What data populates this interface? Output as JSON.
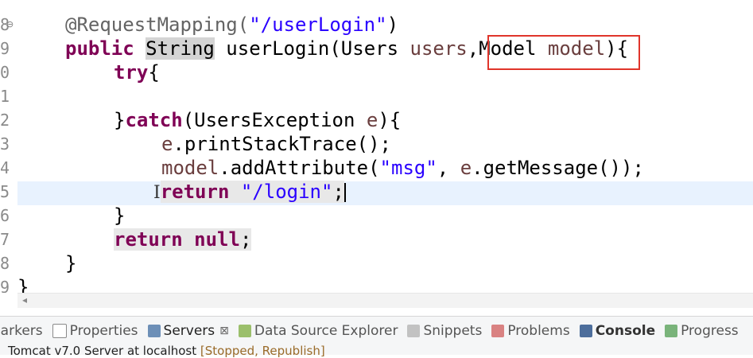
{
  "editor": {
    "line_numbers": [
      "8",
      "9",
      "0",
      "1",
      "2",
      "3",
      "4",
      "5",
      "6",
      "7",
      "8",
      "9"
    ],
    "code": {
      "l1": {
        "annotation": "@RequestMapping(",
        "path": "\"/userLogin\"",
        "close": ")"
      },
      "l2": {
        "kw_public": "public",
        "type_string": "String",
        "sig_a": " userLogin(Users ",
        "param_users": "users",
        "comma": ",",
        "type_model": "Model",
        "space": " ",
        "param_model": "model",
        "close": "){"
      },
      "l3": {
        "kw_try": "try",
        "brace": "{"
      },
      "l4": {
        "close": "}",
        "kw_catch": "catch",
        "rest": "(UsersException ",
        "param_e": "e",
        "end": "){"
      },
      "l5": {
        "var_e": "e",
        "call": ".printStackTrace();"
      },
      "l6": {
        "var_model": "model",
        "call": ".addAttribute(",
        "str_msg": "\"msg\"",
        "mid": ", ",
        "var_e": "e",
        "end": ".getMessage());"
      },
      "l7": {
        "cursor": "I",
        "kw_return": "return",
        "space": " ",
        "str_login": "\"/login\"",
        "semi": ";"
      },
      "l8": {
        "brace": "}"
      },
      "l9": {
        "kw_return": "return",
        "space": " ",
        "kw_null": "null",
        "semi": ";"
      },
      "l10": {
        "brace": "}"
      },
      "l11": {
        "brace": "}"
      }
    }
  },
  "bottom_panel": {
    "tabs": [
      {
        "label": "Markers"
      },
      {
        "label": "Properties"
      },
      {
        "label": "Servers"
      },
      {
        "label": "Data Source Explorer"
      },
      {
        "label": "Snippets"
      },
      {
        "label": "Problems"
      },
      {
        "label": "Console"
      },
      {
        "label": "Progress"
      }
    ],
    "close_glyph": "⊠",
    "server": {
      "name": "Tomcat v7.0 Server at localhost",
      "state": "[Stopped, Republish]"
    }
  },
  "colors": {
    "highlight_box": "#e0352b",
    "keyword": "#7f0055",
    "string": "#2a00ff",
    "current_line": "#e8f2fe"
  }
}
